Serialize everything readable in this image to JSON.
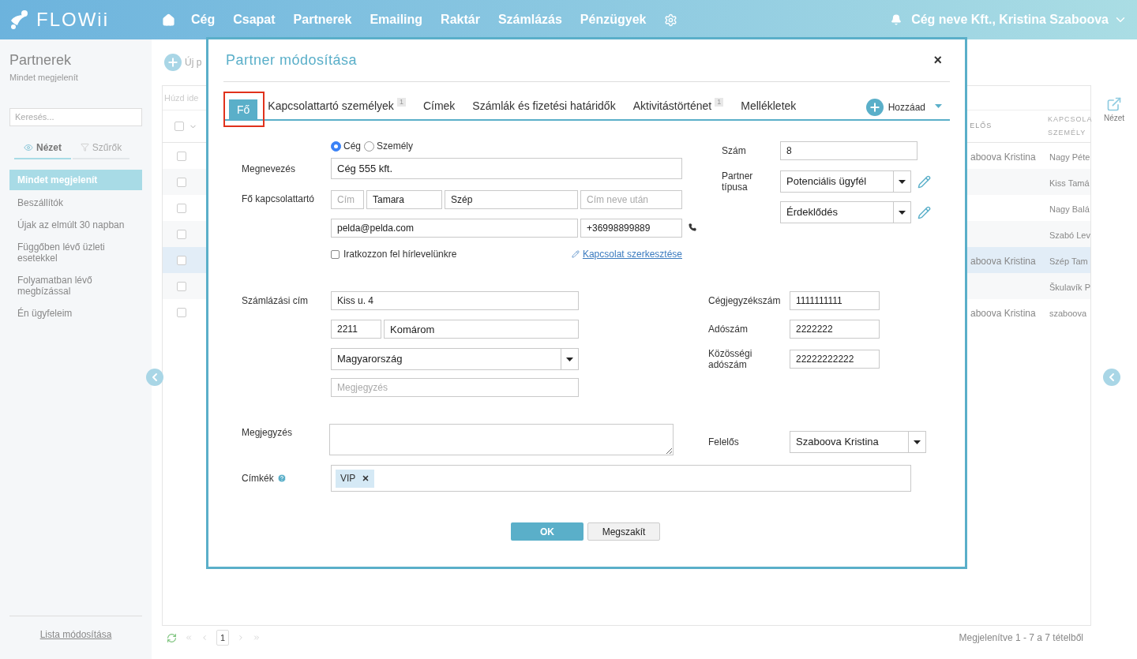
{
  "header": {
    "logo": "FLOWii",
    "nav": [
      {
        "label": "Cég"
      },
      {
        "label": "Csapat"
      },
      {
        "label": "Partnerek"
      },
      {
        "label": "Emailing"
      },
      {
        "label": "Raktár"
      },
      {
        "label": "Számlázás"
      },
      {
        "label": "Pénzügyek"
      }
    ],
    "account": "Cég neve Kft., Kristina Szaboova"
  },
  "sidebar": {
    "title": "Partnerek",
    "subtitle": "Mindet megjelenít",
    "search_placeholder": "Keresés...",
    "tabs": [
      {
        "label": "Nézet",
        "selected": true
      },
      {
        "label": "Szűrők",
        "selected": false
      }
    ],
    "items": [
      {
        "label": "Mindet megjelenít",
        "selected": true
      },
      {
        "label": "Beszállítók",
        "selected": false
      },
      {
        "label": "Újak az elmúlt 30 napban",
        "selected": false
      },
      {
        "label": "Függőben lévő üzleti esetekkel",
        "selected": false
      },
      {
        "label": "Folyamatban lévő megbízással",
        "selected": false
      },
      {
        "label": "Én ügyfeleim",
        "selected": false
      }
    ],
    "footer_link": "Lista módosítása"
  },
  "toolbar": {
    "new_button": "Új p"
  },
  "table": {
    "group_hint": "Húzd ide",
    "header_checked": false,
    "columns": [
      "ELŐS",
      "KAPCSOLA SZEMÉLY"
    ],
    "rows": [
      {
        "column_1": "aboova Kristina",
        "column_2": "Nagy Péte",
        "checked": false,
        "selected": false
      },
      {
        "column_2": "Kiss Tamá",
        "checked": false,
        "selected": false
      },
      {
        "column_2": "Nagy Balá",
        "checked": false,
        "selected": false
      },
      {
        "column_2": "Szabó Lev",
        "checked": false,
        "selected": false
      },
      {
        "column_1": "aboova Kristina",
        "column_2": "Szép Tam",
        "checked": false,
        "selected": true
      },
      {
        "column_2": "Škulavík P",
        "checked": false,
        "selected": false
      },
      {
        "column_1": "aboova Kristina",
        "column_2": "szaboova",
        "checked": false,
        "selected": false
      }
    ]
  },
  "right_panel": {
    "view_label": "Nézet"
  },
  "pager": {
    "page": "1",
    "summary": "Megjelenítve 1 - 7 a 7 tételből"
  },
  "dialog": {
    "title": "Partner módosítása",
    "close": "×",
    "tabs": [
      {
        "label": "Fő",
        "selected": true
      },
      {
        "label": "Kapcsolattartó személyek",
        "badge": "1",
        "selected": false
      },
      {
        "label": "Címek",
        "selected": false
      },
      {
        "label": "Számlák és fizetési határidők",
        "selected": false
      },
      {
        "label": "Aktivitástörténet",
        "badge": "1",
        "selected": false
      },
      {
        "label": "Mellékletek",
        "selected": false
      }
    ],
    "add_button": "Hozzáad",
    "entity_types": [
      {
        "label": "Cég",
        "selected": true
      },
      {
        "label": "Személy",
        "selected": false
      }
    ],
    "name": {
      "label": "Megnevezés",
      "value": "Cég 555 kft."
    },
    "main_contact": {
      "label": "Fő kapcsolattartó",
      "title_placeholder": "Cím",
      "first_name": "Tamara",
      "last_name": "Szép",
      "suffix_placeholder": "Cím neve után",
      "email": "pelda@pelda.com",
      "phone": "+36998899889"
    },
    "newsletter": {
      "label": "Iratkozzon fel hírlevelünkre",
      "checked": false
    },
    "edit_contact_link": "Kapcsolat szerkesztése",
    "number": {
      "label": "Szám",
      "value": "8"
    },
    "partner_type": {
      "label": "Partner típusa",
      "value": "Potenciális ügyfél"
    },
    "stage": {
      "value": "Érdeklődés"
    },
    "billing": {
      "label": "Számlázási cím",
      "street": "Kiss u. 4",
      "zip": "2211",
      "city": "Komárom",
      "country": "Magyarország",
      "note_placeholder": "Megjegyzés"
    },
    "registry": [
      {
        "label": "Cégjegyzékszám",
        "value": "1111111111"
      },
      {
        "label": "Adószám",
        "value": "2222222"
      },
      {
        "label": "Közösségi adószám",
        "value": "22222222222"
      }
    ],
    "note": {
      "label": "Megjegyzés"
    },
    "responsible": {
      "label": "Felelős",
      "value": "Szaboova Kristina"
    },
    "tags": {
      "label": "Címkék",
      "items": [
        {
          "label": "VIP"
        }
      ]
    },
    "buttons": {
      "ok": "OK",
      "cancel": "Megszakít"
    }
  }
}
